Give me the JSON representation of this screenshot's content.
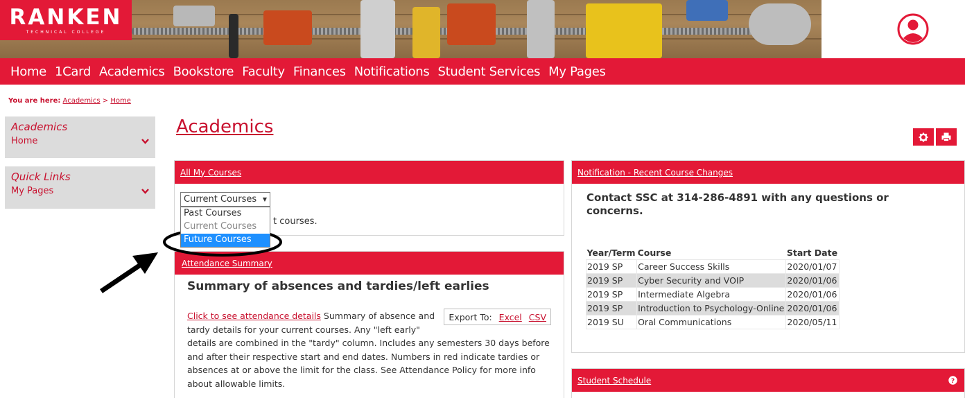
{
  "brand": {
    "name": "RANKEN",
    "tagline": "TECHNICAL COLLEGE",
    "accent_color": "#e31937",
    "link_color": "#c8102e"
  },
  "header": {
    "user_icon": "user-circle-icon"
  },
  "nav": {
    "items": [
      "Home",
      "1Card",
      "Academics",
      "Bookstore",
      "Faculty",
      "Finances",
      "Notifications",
      "Student Services",
      "My Pages"
    ]
  },
  "breadcrumb": {
    "label": "You are here:",
    "items": [
      "Academics",
      "Home"
    ],
    "separator": ">"
  },
  "sidebar": {
    "blocks": [
      {
        "title": "Academics",
        "item": "Home"
      },
      {
        "title": "Quick Links",
        "item": "My Pages"
      }
    ]
  },
  "page": {
    "title": "Academics",
    "tools": [
      "gear-icon",
      "print-icon"
    ]
  },
  "courses_panel": {
    "title": "All My Courses",
    "select_value": "Current Courses",
    "options": [
      "Past Courses",
      "Current Courses",
      "Future Courses"
    ],
    "selected_option": "Future Courses",
    "behind_text": "t courses."
  },
  "attendance_panel": {
    "title": "Attendance Summary",
    "heading": "Summary of absences and tardies/left earlies",
    "link": "Click to see attendance details",
    "body": " Summary of absence and tardy details for your current courses. Any \"left early\" details are combined in the \"tardy\" column. Includes any semesters 30 days before and after their respective start and end dates. Numbers in red indicate tardies or absences at or above the limit for the class. See Attendance Policy for more info about allowable limits.",
    "export_label": "Export To:",
    "export_excel": "Excel",
    "export_csv": "CSV"
  },
  "notification_panel": {
    "title": "Notification - Recent Course Changes",
    "message": "Contact SSC at 314-286-4891 with any questions or concerns.",
    "table": {
      "headers": [
        "Year/Term",
        "Course",
        "Start Date"
      ],
      "rows": [
        [
          "2019 SP",
          "Career Success Skills",
          "2020/01/07"
        ],
        [
          "2019 SP",
          "Cyber Security and VOIP",
          "2020/01/06"
        ],
        [
          "2019 SP",
          "Intermediate Algebra",
          "2020/01/06"
        ],
        [
          "2019 SP",
          "Introduction to Psychology-Online",
          "2020/01/06"
        ],
        [
          "2019 SU",
          "Oral Communications",
          "2020/05/11"
        ]
      ]
    }
  },
  "schedule_panel": {
    "title": "Student Schedule",
    "help_icon": "help-circle-icon"
  }
}
